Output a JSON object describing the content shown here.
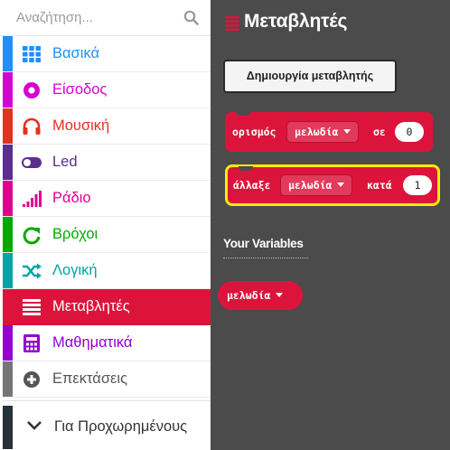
{
  "search": {
    "placeholder": "Αναζήτηση..."
  },
  "categories": [
    {
      "label": "Βασικά",
      "color": "#1e90ff",
      "icon": "grid-icon"
    },
    {
      "label": "Είσοδος",
      "color": "#d400d4",
      "icon": "input-circle-icon"
    },
    {
      "label": "Μουσική",
      "color": "#e63022",
      "icon": "headphones-icon"
    },
    {
      "label": "Led",
      "color": "#5c2d91",
      "icon": "toggle-icon"
    },
    {
      "label": "Ράδιο",
      "color": "#e3008c",
      "icon": "signal-bars-icon"
    },
    {
      "label": "Βρόχοι",
      "color": "#00aa00",
      "icon": "loop-arrow-icon"
    },
    {
      "label": "Λογική",
      "color": "#00a4a6",
      "icon": "shuffle-icon"
    },
    {
      "label": "Μεταβλητές",
      "color": "#dc143c",
      "icon": "list-lines-icon",
      "selected": true
    },
    {
      "label": "Μαθηματικά",
      "color": "#9400d3",
      "icon": "calculator-icon"
    },
    {
      "label": "Επεκτάσεις",
      "color": "#757575",
      "icon": "plus-circle-icon"
    }
  ],
  "advanced": {
    "label": "Για Προχωρημένους",
    "icon": "chevron-down-icon"
  },
  "flyout": {
    "title": "Μεταβλητές",
    "title_icon": "list-lines-icon",
    "create_button": "Δημιουργία μεταβλητής",
    "block_set": {
      "keyword": "ορισμός",
      "variable": "μελωδία",
      "to_word": "σε",
      "value": "0"
    },
    "block_change": {
      "keyword": "άλλαξε",
      "variable": "μελωδία",
      "by_word": "κατά",
      "value": "1"
    },
    "your_variables": "Your Variables",
    "variable_block": {
      "label": "μελωδία"
    },
    "colors": {
      "background": "#4b4b4b",
      "block": "#dc143c",
      "highlight": "#ffea00"
    }
  }
}
